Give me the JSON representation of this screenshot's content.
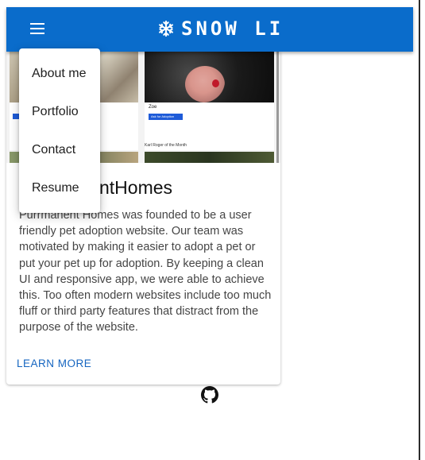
{
  "app_bar": {
    "brand_text": "SNOW LI",
    "brand_icon": "snowflake-icon",
    "menu_icon": "hamburger-menu-icon",
    "bg_color": "#0a6ccb"
  },
  "menu": {
    "items": [
      {
        "label": "About me"
      },
      {
        "label": "Portfolio"
      },
      {
        "label": "Contact"
      },
      {
        "label": "Resume"
      }
    ]
  },
  "card": {
    "title": "PurrmanentHomes",
    "body": "Purrmanent Homes was founded to be a user friendly pet adoption website. Our team was motivated by making it easier to adopt a pet or put your pet up for adoption. By keeping a clean UI and responsive app, we were able to achieve this. Too often modern websites include too much fluff or third party features that distract from the purpose of the website.",
    "action_label": "LEARN MORE",
    "thumb_captions": {
      "zoe": "Zoe",
      "adopt_button": "Ask for Adoption",
      "karl": "Karl Roger of the Month"
    }
  },
  "footer": {
    "github_icon": "github-icon"
  },
  "colors": {
    "accent": "#0a6ccb",
    "link": "#1565c0"
  }
}
